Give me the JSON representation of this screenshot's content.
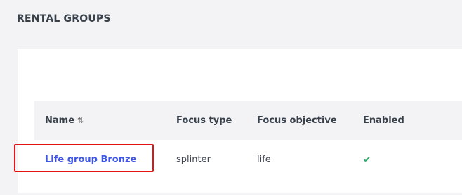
{
  "header": {
    "title": "RENTAL GROUPS"
  },
  "table": {
    "columns": [
      {
        "label": "Name",
        "sortable": true,
        "sort_icon": "sort-arrows-icon"
      },
      {
        "label": "Focus type"
      },
      {
        "label": "Focus objective"
      },
      {
        "label": "Enabled"
      }
    ],
    "rows": [
      {
        "name": "Life group Bronze",
        "focus_type": "splinter",
        "focus_objective": "life",
        "enabled": true,
        "enabled_icon": "checkmark-icon"
      }
    ]
  },
  "colors": {
    "link": "#3d56e8",
    "check": "#2fae6b",
    "highlight": "#e31414",
    "header_bg": "#f3f3f6"
  }
}
